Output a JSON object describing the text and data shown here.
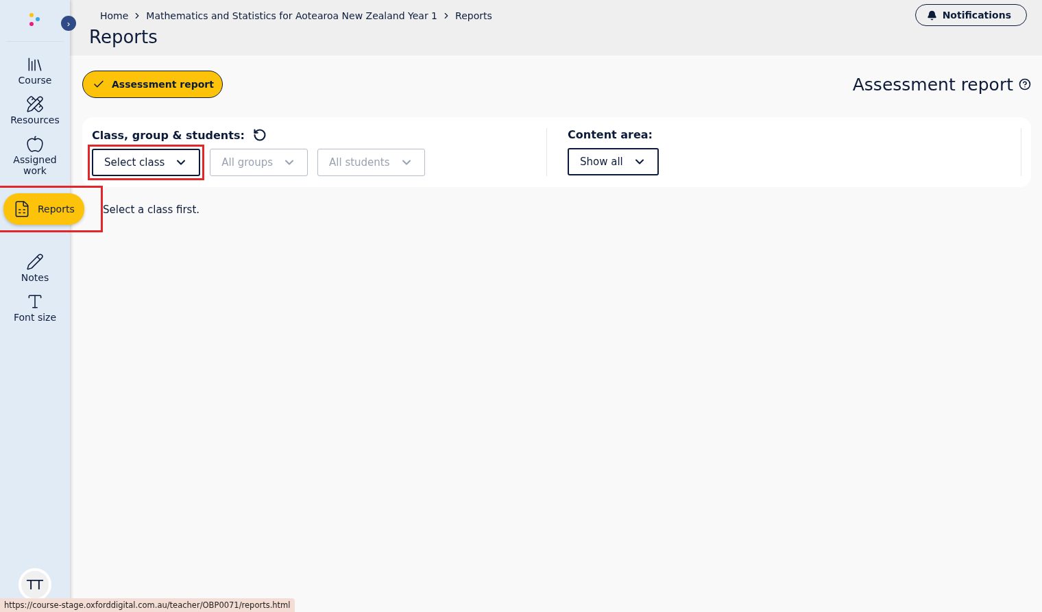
{
  "sidebar": {
    "expand_button": "›",
    "items": [
      {
        "kind": "course",
        "label": "Course",
        "selected": false,
        "highlighted": false
      },
      {
        "kind": "resources",
        "label": "Resources",
        "selected": false,
        "highlighted": false
      },
      {
        "kind": "assigned",
        "label": "Assigned work",
        "selected": false,
        "highlighted": false
      },
      {
        "kind": "reports",
        "label": "Reports",
        "selected": true,
        "highlighted": true
      },
      {
        "kind": "notes",
        "label": "Notes",
        "selected": false,
        "highlighted": false
      },
      {
        "kind": "font",
        "label": "Font size",
        "selected": false,
        "highlighted": false
      }
    ],
    "avatar": "TT"
  },
  "header": {
    "breadcrumb": [
      "Home",
      "Mathematics and Statistics for Aotearoa New Zealand Year 1",
      "Reports"
    ],
    "title": "Reports",
    "notifications": "Notifications"
  },
  "report_chip": {
    "label": "Assessment report",
    "selected": true
  },
  "report_title": "Assessment report",
  "filters": {
    "label": "Class, group & students:",
    "dropdowns": [
      {
        "value": "Select class",
        "disabled": false,
        "highlighted": true
      },
      {
        "value": "All groups",
        "disabled": true,
        "highlighted": false
      },
      {
        "value": "All students",
        "disabled": true,
        "highlighted": false
      }
    ],
    "content_label": "Content area:",
    "content_dropdown": {
      "value": "Show all",
      "disabled": false,
      "highlighted": false
    }
  },
  "message": "Select a class first.",
  "status_url": "https://course-stage.oxforddigital.com.au/teacher/OBP0071/reports.html"
}
